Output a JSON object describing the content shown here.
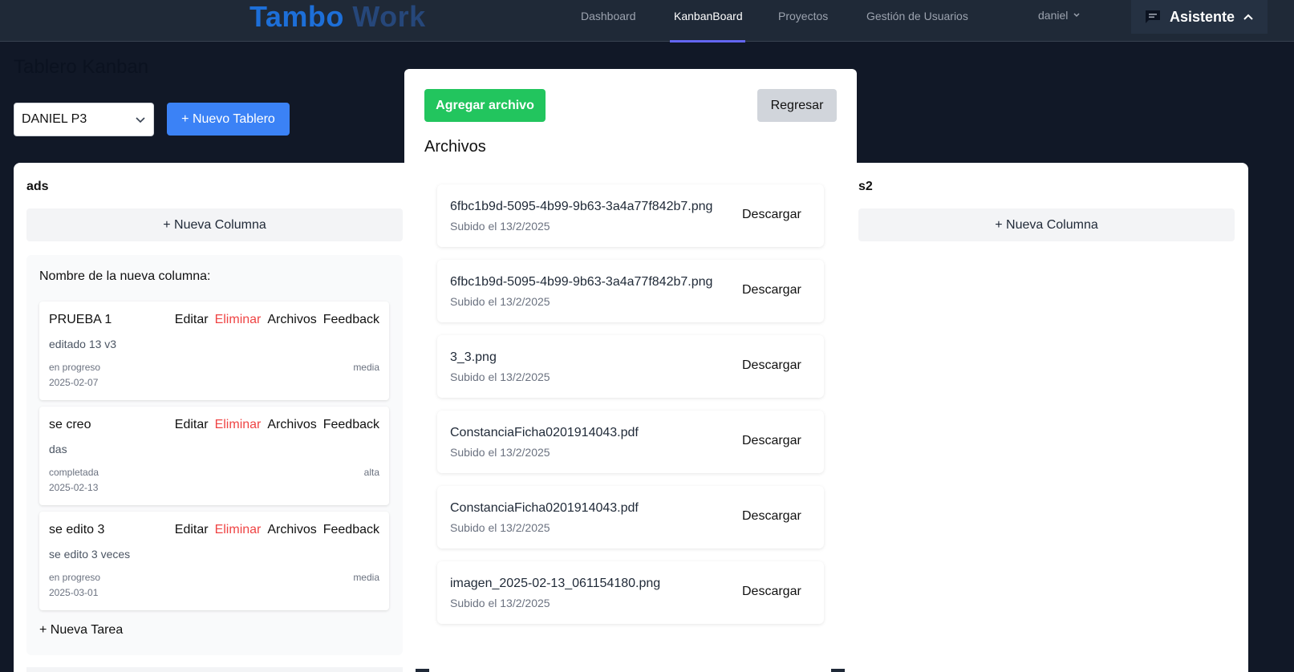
{
  "navbar": {
    "brand_part1": "Tambo ",
    "brand_part2": "Work",
    "links": [
      "Dashboard",
      "KanbanBoard",
      "Proyectos",
      "Gestión de Usuarios"
    ],
    "active_link": "KanbanBoard",
    "user": "daniel",
    "assistant_label": "Asistente"
  },
  "page": {
    "title": "Tablero Kanban",
    "board_select_value": "DANIEL P3",
    "new_board_label": "+ Nuevo Tablero"
  },
  "board_left": {
    "title": "ads",
    "new_column_label": "+ Nueva Columna",
    "column": {
      "label": "Nombre de la nueva columna:",
      "tasks": [
        {
          "title": "PRUEBA 1",
          "desc": "editado 13 v3",
          "status": "en progreso",
          "priority": "media",
          "date": "2025-02-07"
        },
        {
          "title": "se creo",
          "desc": "das",
          "status": "completada",
          "priority": "alta",
          "date": "2025-02-13"
        },
        {
          "title": "se edito 3",
          "desc": "se edito 3 veces",
          "status": "en progreso",
          "priority": "media",
          "date": "2025-03-01"
        }
      ],
      "actions": {
        "edit": "Editar",
        "delete": "Eliminar",
        "files": "Archivos",
        "feedback": "Feedback"
      },
      "new_task_label": "+ Nueva Tarea"
    }
  },
  "board_right": {
    "title": "s2",
    "new_column_label": "+ Nueva Columna"
  },
  "modal": {
    "add_file_label": "Agregar archivo",
    "back_label": "Regresar",
    "title": "Archivos",
    "download_label": "Descargar",
    "files": [
      {
        "name": "6fbc1b9d-5095-4b99-9b63-3a4a77f842b7.png",
        "uploaded": "Subido el 13/2/2025"
      },
      {
        "name": "6fbc1b9d-5095-4b99-9b63-3a4a77f842b7.png",
        "uploaded": "Subido el 13/2/2025"
      },
      {
        "name": "3_3.png",
        "uploaded": "Subido el 13/2/2025"
      },
      {
        "name": "ConstanciaFicha0201914043.pdf",
        "uploaded": "Subido el 13/2/2025"
      },
      {
        "name": "ConstanciaFicha0201914043.pdf",
        "uploaded": "Subido el 13/2/2025"
      },
      {
        "name": "imagen_2025-02-13_061154180.png",
        "uploaded": "Subido el 13/2/2025"
      }
    ]
  },
  "colors": {
    "background": "#111827",
    "navbar": "#1f2937",
    "primary": "#3b82f6",
    "success": "#22c55e",
    "danger": "#ef4444",
    "nav_active_underline": "#6366f1"
  },
  "icons": {
    "select_caret": "chevron-down-icon",
    "user_caret": "chevron-down-icon",
    "assistant": "chat-icon",
    "assistant_toggle": "chevron-up-icon"
  }
}
